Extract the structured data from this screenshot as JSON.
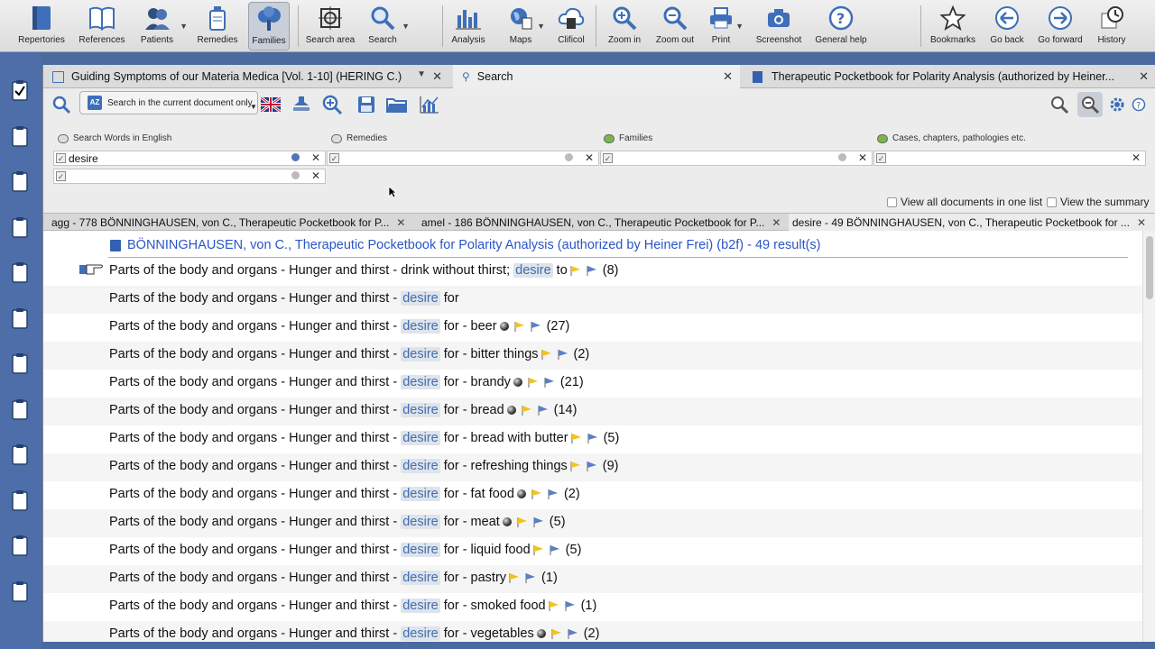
{
  "toolbar": {
    "repertories": "Repertories",
    "references": "References",
    "patients": "Patients",
    "remedies": "Remedies",
    "families": "Families",
    "search_area": "Search area",
    "search": "Search",
    "analysis": "Analysis",
    "maps": "Maps",
    "clificol": "Clificol",
    "zoom_in": "Zoom in",
    "zoom_out": "Zoom out",
    "print": "Print",
    "screenshot": "Screenshot",
    "general_help": "General help",
    "bookmarks": "Bookmarks",
    "go_back": "Go back",
    "go_forward": "Go forward",
    "history": "History"
  },
  "doc_tabs": [
    "Guiding Symptoms of our Materia Medica [Vol. 1-10] (HERING C.)",
    "Search",
    "Therapeutic Pocketbook for Polarity Analysis (authorized by Heiner..."
  ],
  "search_toolbar": {
    "scope_label": "Search in the current document only"
  },
  "criteria": {
    "words_label": "Search Words in English",
    "remedies_label": "Remedies",
    "families_label": "Families",
    "cases_label": "Cases, chapters, pathologies etc.",
    "word_value": "desire"
  },
  "options": {
    "all_in_one": "View all documents in one list",
    "summary": "View the summary"
  },
  "result_tabs": [
    "agg - 778 BÖNNINGHAUSEN, von C., Therapeutic Pocketbook for P...",
    "amel - 186 BÖNNINGHAUSEN, von C., Therapeutic Pocketbook for P...",
    "desire - 49 BÖNNINGHAUSEN, von C., Therapeutic Pocketbook for ..."
  ],
  "results": {
    "header": "BÖNNINGHAUSEN, von C., Therapeutic Pocketbook for Polarity Analysis (authorized by Heiner Frei) (b2f) - 49 result(s)",
    "prefix": "Parts of the body and organs - Hunger and thirst -",
    "rows": [
      {
        "pre": "drink without thirst;",
        "kw": "desire",
        "post": "to",
        "ball": false,
        "flags": true,
        "count": "(8)"
      },
      {
        "pre": "",
        "kw": "desire",
        "post": "for",
        "ball": false,
        "flags": false,
        "count": ""
      },
      {
        "pre": "",
        "kw": "desire",
        "post": "for - beer",
        "ball": true,
        "flags": true,
        "count": "(27)"
      },
      {
        "pre": "",
        "kw": "desire",
        "post": "for - bitter things",
        "ball": false,
        "flags": true,
        "count": "(2)"
      },
      {
        "pre": "",
        "kw": "desire",
        "post": "for - brandy",
        "ball": true,
        "flags": true,
        "count": "(21)"
      },
      {
        "pre": "",
        "kw": "desire",
        "post": "for - bread",
        "ball": true,
        "flags": true,
        "count": "(14)"
      },
      {
        "pre": "",
        "kw": "desire",
        "post": "for - bread with butter",
        "ball": false,
        "flags": true,
        "count": "(5)"
      },
      {
        "pre": "",
        "kw": "desire",
        "post": "for - refreshing things",
        "ball": false,
        "flags": true,
        "count": "(9)"
      },
      {
        "pre": "",
        "kw": "desire",
        "post": "for - fat food",
        "ball": true,
        "flags": true,
        "count": "(2)"
      },
      {
        "pre": "",
        "kw": "desire",
        "post": "for - meat",
        "ball": true,
        "flags": true,
        "count": "(5)"
      },
      {
        "pre": "",
        "kw": "desire",
        "post": "for - liquid food",
        "ball": false,
        "flags": true,
        "count": "(5)"
      },
      {
        "pre": "",
        "kw": "desire",
        "post": "for - pastry",
        "ball": false,
        "flags": true,
        "count": "(1)"
      },
      {
        "pre": "",
        "kw": "desire",
        "post": "for - smoked food",
        "ball": false,
        "flags": true,
        "count": "(1)"
      },
      {
        "pre": "",
        "kw": "desire",
        "post": "for - vegetables",
        "ball": true,
        "flags": true,
        "count": "(2)"
      }
    ]
  },
  "colors": {
    "accent": "#2a55c8",
    "highlight_bg": "#dfe3ea",
    "highlight_text": "#3f6fb0",
    "gutter": "#4d6ea8"
  }
}
